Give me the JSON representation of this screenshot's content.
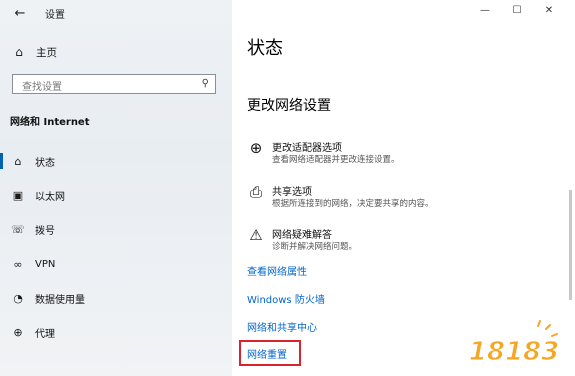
{
  "window": {
    "title": "设置",
    "controls": {
      "minimize": "—",
      "maximize": "☐",
      "close": "✕"
    }
  },
  "sidebar": {
    "home_label": "主页",
    "search_placeholder": "查找设置",
    "section_title": "网络和 Internet",
    "items": [
      {
        "label": "状态",
        "icon": "status-icon",
        "selected": true
      },
      {
        "label": "以太网",
        "icon": "ethernet-icon",
        "selected": false
      },
      {
        "label": "拨号",
        "icon": "dialup-icon",
        "selected": false
      },
      {
        "label": "VPN",
        "icon": "vpn-icon",
        "selected": false
      },
      {
        "label": "数据使用量",
        "icon": "data-usage-icon",
        "selected": false
      },
      {
        "label": "代理",
        "icon": "proxy-icon",
        "selected": false
      }
    ]
  },
  "main": {
    "page_title": "状态",
    "section_heading": "更改网络设置",
    "options": [
      {
        "title": "更改适配器选项",
        "desc": "查看网络适配器并更改连接设置。",
        "icon": "adapter-icon"
      },
      {
        "title": "共享选项",
        "desc": "根据所连接到的网络，决定要共享的内容。",
        "icon": "sharing-icon"
      },
      {
        "title": "网络疑难解答",
        "desc": "诊断并解决网络问题。",
        "icon": "troubleshoot-icon"
      }
    ],
    "links": {
      "view_properties": "查看网络属性",
      "firewall": "Windows 防火墙",
      "sharing_center": "网络和共享中心",
      "network_reset": "网络重置"
    }
  },
  "watermark": {
    "text": "18183"
  },
  "colors": {
    "accent": "#0063b1",
    "link": "#0066cc",
    "highlight_box": "#d9232e",
    "watermark": "#f5a623"
  }
}
